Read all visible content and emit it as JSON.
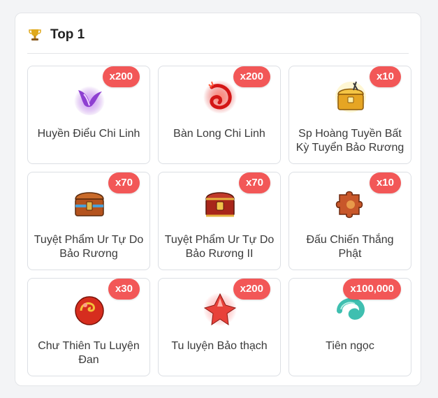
{
  "header": {
    "title": "Top 1",
    "icon": "trophy-icon",
    "accent": "#d4a017"
  },
  "badge_color": "#f25757",
  "items": [
    {
      "name": "Huyền Điểu Chi Linh",
      "qty": "x200",
      "icon": "purple-bird-spirit-icon"
    },
    {
      "name": "Bàn Long Chi Linh",
      "qty": "x200",
      "icon": "red-dragon-spirit-icon"
    },
    {
      "name": "Sp Hoàng Tuyền Bất Kỳ Tuyển Bảo Rương",
      "qty": "x10",
      "icon": "golden-chest-icon"
    },
    {
      "name": "Tuyệt Phẩm Ur Tự Do Bảo Rương",
      "qty": "x70",
      "icon": "ornate-chest-icon"
    },
    {
      "name": "Tuyệt Phẩm Ur Tự Do Bảo Rương II",
      "qty": "x70",
      "icon": "ornate-chest-icon"
    },
    {
      "name": "Đấu Chiến Thắng Phật",
      "qty": "x10",
      "icon": "puzzle-piece-icon"
    },
    {
      "name": "Chư Thiên Tu Luyện Đan",
      "qty": "x30",
      "icon": "red-pill-icon"
    },
    {
      "name": "Tu luyện Bảo thạch",
      "qty": "x200",
      "icon": "red-gem-icon"
    },
    {
      "name": "Tiên ngọc",
      "qty": "x100,000",
      "icon": "jade-icon"
    }
  ]
}
